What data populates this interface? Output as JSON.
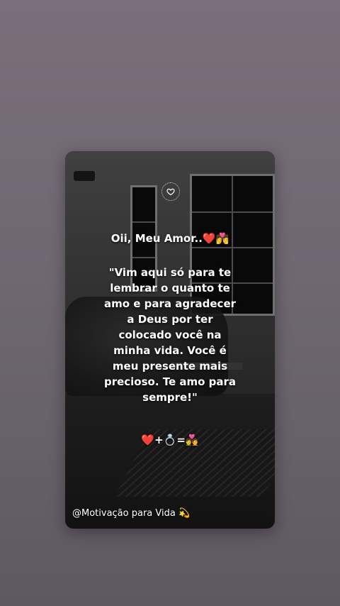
{
  "story": {
    "greeting": "Oii, Meu Amor..❤️💏",
    "quote": "\"Vim aqui só para te lembrar o quanto te amo e para agradecer a Deus por ter colocado você na minha vida. Você é meu presente mais precioso. Te amo para sempre!\"",
    "equation": "❤️+💍=💑",
    "credit": "@Motivação para Vida 💫"
  },
  "icons": {
    "badge": "heart-outline-icon"
  },
  "colors": {
    "background": "#756d76",
    "text": "#ffffff"
  }
}
